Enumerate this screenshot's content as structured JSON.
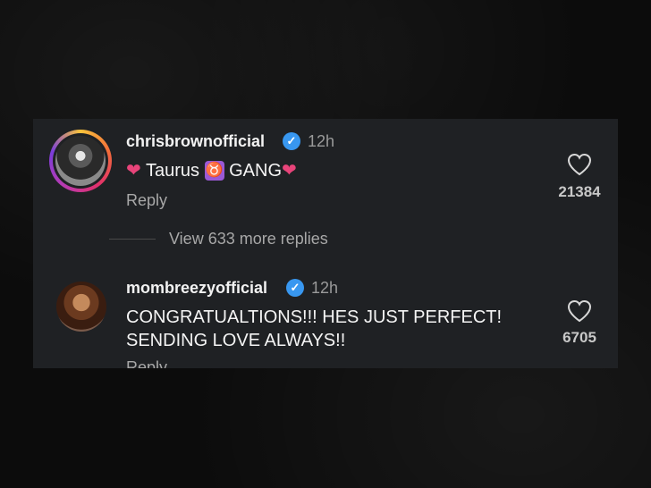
{
  "comments": [
    {
      "username": "chrisbrownofficial",
      "time": "12h",
      "text_prefix": "❤️ Taurus ",
      "zodiac_symbol": "♉",
      "text_suffix": " GANG❤️",
      "reply_label": "Reply",
      "like_count": "21384",
      "avatar": "avatar-with-story-ring"
    },
    {
      "username": "mombreezyofficial",
      "time": "12h",
      "text_line1": "CONGRATUALTIONS!!! HES JUST PERFECT!",
      "text_line2": "SENDING LOVE ALWAYS!!",
      "reply_label": "Reply",
      "like_count": "6705",
      "avatar": "avatar"
    }
  ],
  "view_more_replies": "View 633 more replies",
  "verified_icon": "checkmark",
  "like_icon": "heart-outline-icon",
  "colors": {
    "card_bg": "#1f2124",
    "verified": "#3897f0",
    "heart": "#e8447a",
    "zodiac_bg": "#9b59d6"
  }
}
